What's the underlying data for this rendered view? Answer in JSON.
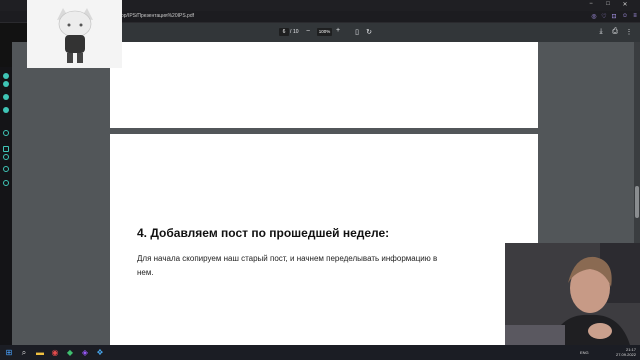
{
  "browser": {
    "url": "op/IPS/Презентация%20IPS.pdf",
    "controls": [
      "−",
      "□",
      "✕"
    ]
  },
  "pdf_toolbar": {
    "current_page": "6",
    "page_separator": "/",
    "total_pages": "10",
    "zoom_out": "−",
    "zoom": "100%",
    "zoom_in": "+"
  },
  "document": {
    "heading": "4. Добавляем пост по прошедшей неделе:",
    "body_line1": "Для начала скопируем наш старый пост, и начнем переделывать информацию в",
    "body_line2": "нем."
  },
  "taskbar": {
    "language": "ENG",
    "time": "21:17",
    "date": "27.09.2022"
  },
  "colors": {
    "accent": "#b7a1ff",
    "sidebar_icon_teal": "#3fc5b6"
  },
  "icons": {
    "download": "download-icon",
    "print": "print-icon",
    "more": "more-vert-icon"
  }
}
